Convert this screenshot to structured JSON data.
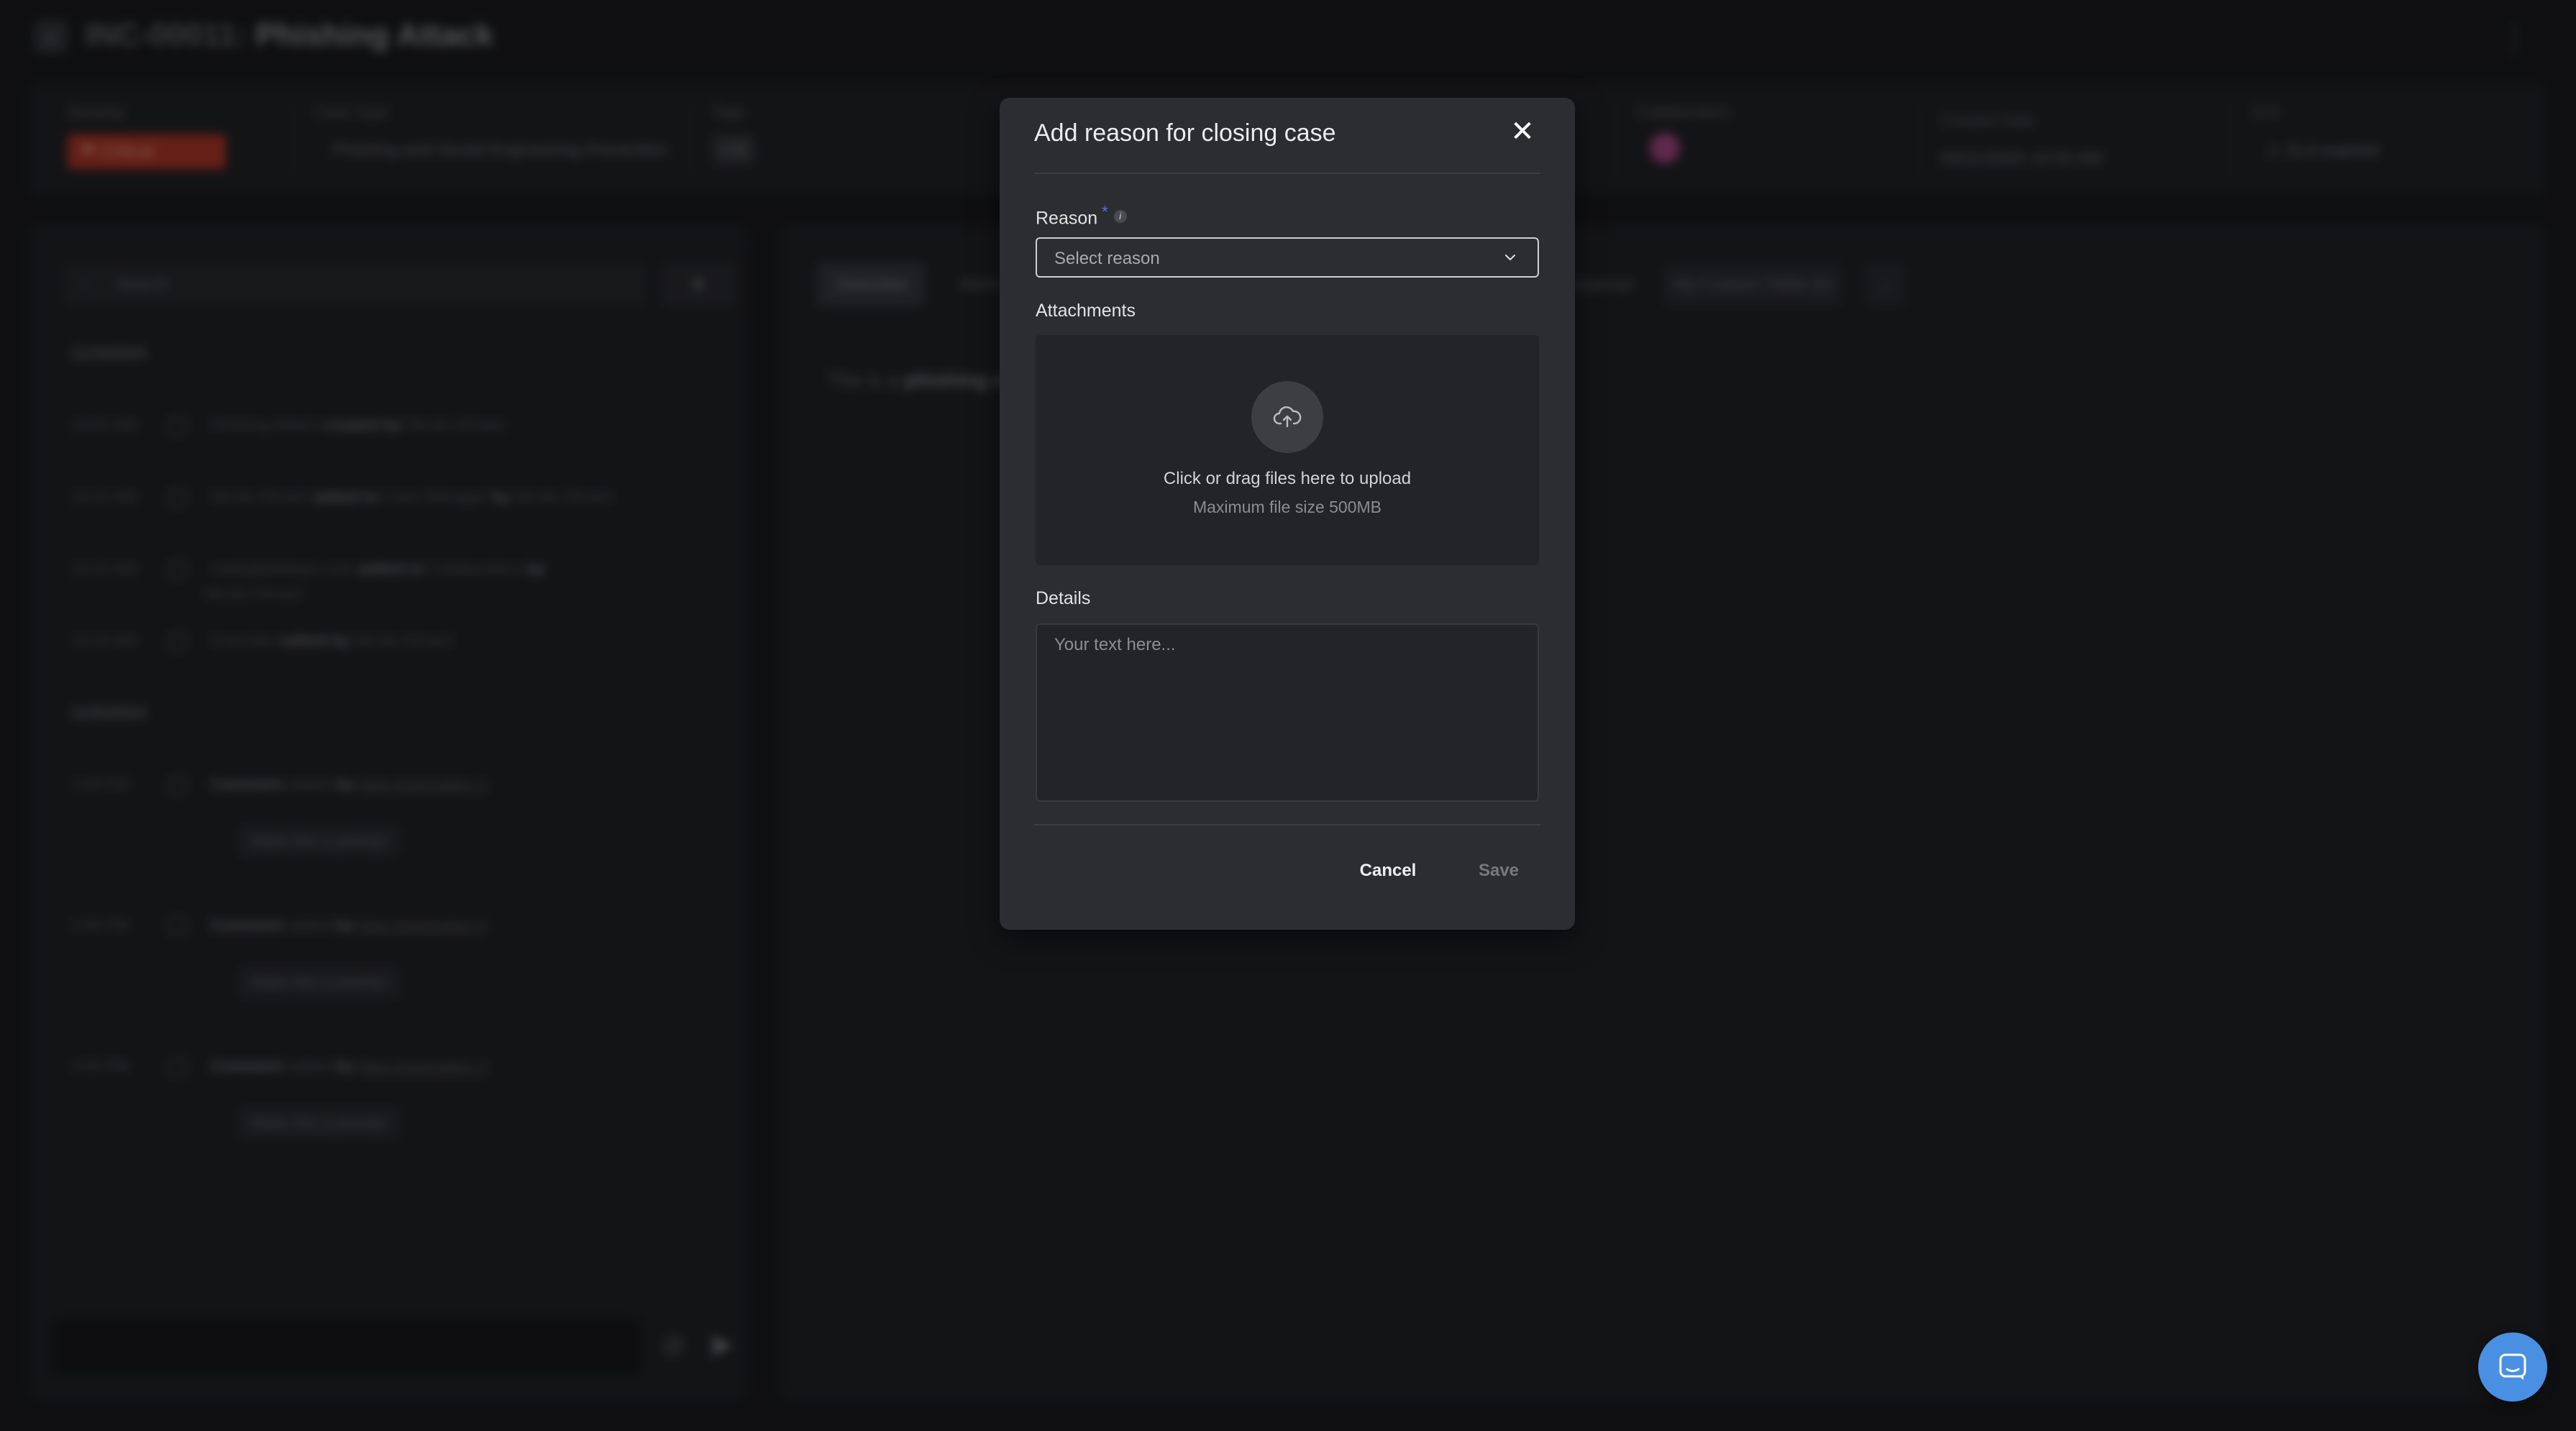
{
  "header": {
    "case_id": "INC-00011:",
    "case_name": "Phishing Attack",
    "back_icon": "chevron-left-icon",
    "menu_icon": "kebab-menu-icon"
  },
  "info_bar": {
    "severity": {
      "label": "Severity",
      "value": "Critical",
      "color": "#b93a28"
    },
    "case_type": {
      "label": "Case Type",
      "value": "Phishing and Social Engineering Prevention"
    },
    "tags": {
      "label": "Tags",
      "value": "+ 0"
    },
    "collaborators": {
      "label": "Collaborators"
    },
    "created_date": {
      "label": "Created Date",
      "value": "03/11/2024 10:02 AM"
    },
    "sla": {
      "label": "SLA",
      "value": "SLA expired",
      "color": "#b84436"
    }
  },
  "activity": {
    "search_placeholder": "Search",
    "groups": [
      {
        "date": "11/3/2024",
        "items": [
          {
            "time": "10:02 AM",
            "text": "Phishing Attack",
            "verb": "created by",
            "actor": "Nicola Dimant"
          },
          {
            "time": "10:21 AM",
            "text": "Nicola Dimant",
            "verb": "added to",
            "target": "Case Manager",
            "by": "by",
            "actor": "Nicola Dimant"
          },
          {
            "time": "10:21 AM",
            "text": "mark@blinkops.com",
            "verb": "added to",
            "target": "Collaborators",
            "by": "by",
            "actor": "Nicola Dimant"
          },
          {
            "time": "10:23 AM",
            "text": "Overview",
            "verb": "edited by",
            "actor": "Nicola Dimant"
          }
        ]
      },
      {
        "date": "11/5/2024",
        "comments": [
          {
            "time": "1:06 PM",
            "label": "Comment",
            "verb": "added",
            "by": "by",
            "actor": "New Automation 4",
            "body": "Make this a priority!"
          },
          {
            "time": "2:06 PM",
            "label": "Comment",
            "verb": "added",
            "by": "by",
            "actor": "New Automation 4",
            "body": "Make this a priority!"
          },
          {
            "time": "3:06 PM",
            "label": "Comment",
            "verb": "added",
            "by": "by",
            "actor": "New Automation 4",
            "body": "Make this a priority!"
          }
        ]
      }
    ]
  },
  "main": {
    "tabs": [
      {
        "label": "Overview"
      },
      {
        "label": "Alerts"
      },
      {
        "label": "Response"
      },
      {
        "label": "My Custom Table (0)"
      }
    ],
    "overview_prefix": "The is a",
    "overview_bold": "phishing a"
  },
  "modal": {
    "title": "Add reason for closing case",
    "reason_label": "Reason",
    "required_mark": "*",
    "info_glyph": "i",
    "reason_placeholder": "Select reason",
    "attachments_label": "Attachments",
    "upload_text": "Click or drag files here to upload",
    "upload_limit": "Maximum file size 500MB",
    "details_label": "Details",
    "details_placeholder": "Your text here...",
    "cancel_label": "Cancel",
    "save_label": "Save",
    "accent_color": "#4a7be0"
  },
  "chat_widget": {
    "icon": "chat-bubble-icon",
    "color": "#4a90e2"
  }
}
